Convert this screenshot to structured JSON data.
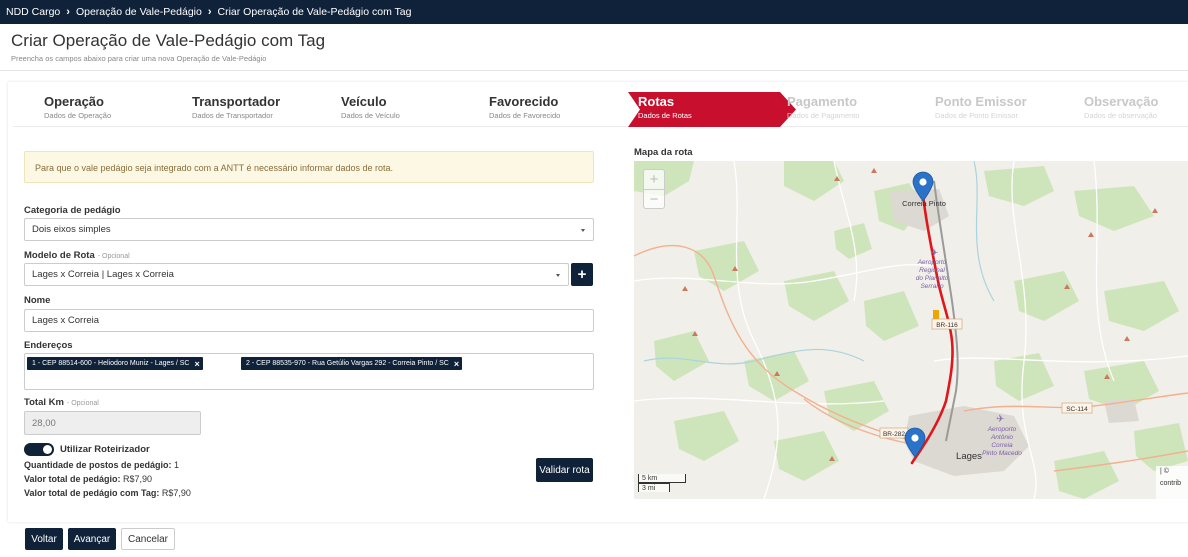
{
  "breadcrumb": {
    "items": [
      "NDD Cargo",
      "Operação de Vale-Pedágio",
      "Criar Operação de Vale-Pedágio com Tag"
    ]
  },
  "page": {
    "title": "Criar Operação de Vale-Pedágio com Tag",
    "subtitle": "Preencha os campos abaixo para criar uma nova Operação de Vale-Pedágio"
  },
  "stepper": {
    "steps": [
      {
        "title": "Operação",
        "sub": "Dados de Operação",
        "state": "done"
      },
      {
        "title": "Transportador",
        "sub": "Dados de Transportador",
        "state": "done"
      },
      {
        "title": "Veículo",
        "sub": "Dados de Veículo",
        "state": "done"
      },
      {
        "title": "Favorecido",
        "sub": "Dados de Favorecido",
        "state": "done"
      },
      {
        "title": "Rotas",
        "sub": "Dados de Rotas",
        "state": "active"
      },
      {
        "title": "Pagamento",
        "sub": "Dados de Pagamento",
        "state": "disabled"
      },
      {
        "title": "Ponto Emissor",
        "sub": "Dados de Ponto Emissor",
        "state": "disabled"
      },
      {
        "title": "Observação",
        "sub": "Dados de observação",
        "state": "disabled"
      }
    ],
    "active_color": "#c8102e"
  },
  "alert": {
    "text": "Para que o vale pedágio seja integrado com a ANTT é necessário informar dados de rota."
  },
  "form": {
    "categoria": {
      "label": "Categoria de pedágio",
      "value": "Dois eixos simples"
    },
    "modelo": {
      "label": "Modelo de Rota",
      "optional": "- Opcional",
      "value": "Lages x Correia  |  Lages x Correia"
    },
    "nome": {
      "label": "Nome",
      "value": "Lages x Correia"
    },
    "enderecos": {
      "label": "Endereços",
      "tags": [
        "1  - CEP 88514-600  - Heliodoro Muniz  - Lages /  SC",
        "2  - CEP 88535-970  - Rua Getúlio Vargas 292  - Correia Pinto /  SC"
      ]
    },
    "total_km": {
      "label": "Total Km",
      "optional": "- Opcional",
      "value": "28,00"
    },
    "roteirizador": {
      "label": "Utilizar Roteirizador",
      "enabled": true
    }
  },
  "summary": {
    "postos_label": "Quantidade de postos de pedágio:",
    "postos_value": "1",
    "valor_label": "Valor total de pedágio:",
    "valor_value": "R$7,90",
    "valor_tag_label": "Valor total de pedágio com Tag:",
    "valor_tag_value": "R$7,90"
  },
  "buttons": {
    "validar": "Validar rota",
    "voltar": "Voltar",
    "avancar": "Avançar",
    "cancelar": "Cancelar",
    "add": "+"
  },
  "map": {
    "label": "Mapa da rota",
    "zoom_in": "+",
    "zoom_out": "−",
    "places": {
      "correia_pinto": "Correia Pinto",
      "lages": "Lages",
      "aeroporto_serrano": [
        "Aeroporto",
        "Regional",
        "do Planalto",
        "Serrano"
      ],
      "aeroporto_lages": [
        "Aeroporto",
        "Antônio",
        "Correia",
        "Pinto Macedo"
      ]
    },
    "roads": {
      "br116": "BR-116",
      "br282": "BR-282",
      "sc114": "SC-114"
    },
    "scale_km": "5 km",
    "scale_mi": "3 mi",
    "attribution": [
      "| ©",
      "contrib"
    ],
    "route_color": "#e0161b",
    "marker_color": "#2a73c8"
  },
  "colors": {
    "primary": "#0f2239",
    "alert_bg": "#fcf8e3",
    "alert_text": "#8a6d3b"
  }
}
